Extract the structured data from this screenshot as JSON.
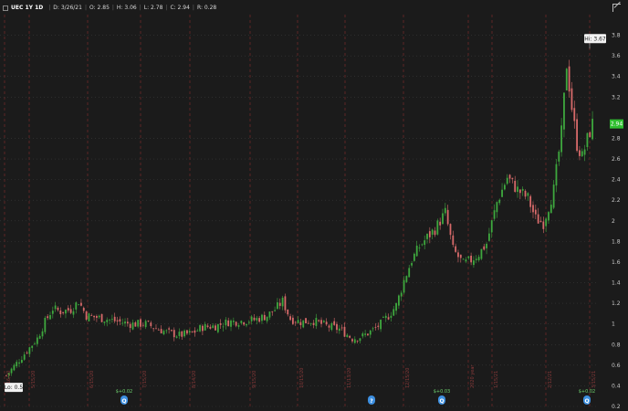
{
  "header": {
    "symbol": "UEC 1Y 1D",
    "date": "D: 3/26/21",
    "open": "O: 2.85",
    "high": "H: 3.06",
    "low": "L: 2.78",
    "close": "C: 2.94",
    "range": "R: 0.28"
  },
  "colors": {
    "background": "#1b1b1b",
    "up": "#3ea83e",
    "down": "#d76a6a",
    "price_tag": "#2fbf2f",
    "event_marker": "#3d8fe0",
    "dividend_text": "#6fd36f"
  },
  "icons": {
    "settings": "expand-corner-icon"
  },
  "chart_data": {
    "type": "candlestick",
    "ylim": [
      0.2,
      4.0
    ],
    "y_ticks": [
      "0.2",
      "0.4",
      "0.6",
      "0.8",
      "1",
      "1.2",
      "1.4",
      "1.6",
      "1.8",
      "2",
      "2.2",
      "2.4",
      "2.6",
      "2.8",
      "3.2",
      "3.4",
      "3.6",
      "3.8"
    ],
    "x_labels": [
      "4/16/20",
      "5/15/20",
      "6/15/20",
      "7/15/20",
      "8/14/20",
      "9/15/20",
      "10/15/20",
      "11/13/20",
      "12/15/20",
      "2020 year",
      "1/15/21",
      "2/12/21",
      "3/15/21"
    ],
    "current_price_label": "2.94",
    "current_price": 2.94,
    "high_label": "Hi: 3.67",
    "high": 3.67,
    "low_label": "Lo: 0.5",
    "low": 0.5,
    "dividends": [
      {
        "label": "$+0.02",
        "marker": "Q"
      },
      {
        "label": "?",
        "marker": "?"
      },
      {
        "label": "$+0.03",
        "marker": "Q"
      },
      {
        "label": "$+0.02",
        "marker": "Q"
      }
    ],
    "price_path": [
      [
        0,
        0.5
      ],
      [
        4,
        0.62
      ],
      [
        8,
        0.74
      ],
      [
        12,
        0.86
      ],
      [
        15,
        1.02
      ],
      [
        18,
        1.15
      ],
      [
        21,
        1.12
      ],
      [
        25,
        1.14
      ],
      [
        28,
        1.22
      ],
      [
        31,
        1.08
      ],
      [
        36,
        1.06
      ],
      [
        42,
        1.03
      ],
      [
        48,
        1.0
      ],
      [
        54,
        1.0
      ],
      [
        58,
        0.96
      ],
      [
        62,
        0.92
      ],
      [
        67,
        0.89
      ],
      [
        72,
        0.91
      ],
      [
        76,
        0.97
      ],
      [
        81,
        0.98
      ],
      [
        86,
        1.02
      ],
      [
        92,
        1.03
      ],
      [
        96,
        1.04
      ],
      [
        101,
        1.08
      ],
      [
        104,
        1.14
      ],
      [
        107,
        1.22
      ],
      [
        110,
        1.05
      ],
      [
        114,
        1.02
      ],
      [
        119,
        1.03
      ],
      [
        124,
        0.98
      ],
      [
        129,
        0.95
      ],
      [
        134,
        0.86
      ],
      [
        138,
        0.88
      ],
      [
        142,
        0.94
      ],
      [
        145,
        1.0
      ],
      [
        148,
        1.08
      ],
      [
        151,
        1.18
      ],
      [
        154,
        1.42
      ],
      [
        157,
        1.62
      ],
      [
        160,
        1.75
      ],
      [
        163,
        1.84
      ],
      [
        166,
        1.92
      ],
      [
        170,
        2.08
      ],
      [
        173,
        1.72
      ],
      [
        177,
        1.58
      ],
      [
        180,
        1.62
      ],
      [
        183,
        1.68
      ],
      [
        186,
        1.78
      ],
      [
        190,
        2.18
      ],
      [
        194,
        2.42
      ],
      [
        198,
        2.3
      ],
      [
        202,
        2.22
      ],
      [
        205,
        2.02
      ],
      [
        208,
        1.98
      ],
      [
        212,
        2.3
      ],
      [
        215,
        2.85
      ],
      [
        217,
        3.52
      ],
      [
        219,
        3.1
      ],
      [
        221,
        2.74
      ],
      [
        223,
        2.62
      ],
      [
        225,
        2.79
      ],
      [
        227,
        2.94
      ]
    ]
  }
}
